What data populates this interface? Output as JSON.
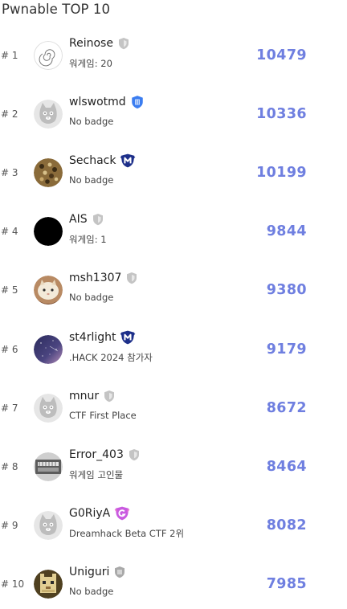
{
  "title": "Pwnable TOP 10",
  "accent_color": "#6f7fe0",
  "rows": [
    {
      "rank": "# 1",
      "name": "Reinose",
      "badge": "gray-shield-icon",
      "sub": "워게임: 20",
      "score": "10479",
      "avatar": "spiral"
    },
    {
      "rank": "# 2",
      "name": "wlswotmd",
      "badge": "blue-shield-icon",
      "sub": "No badge",
      "score": "10336",
      "avatar": "cat"
    },
    {
      "rank": "# 3",
      "name": "Sechack",
      "badge": "navy-m-shield-icon",
      "sub": "No badge",
      "score": "10199",
      "avatar": "leopard"
    },
    {
      "rank": "# 4",
      "name": "AIS",
      "badge": "gray-shield-icon",
      "sub": "워게임: 1",
      "score": "9844",
      "avatar": "black"
    },
    {
      "rank": "# 5",
      "name": "msh1307",
      "badge": "gray-shield-icon",
      "sub": "No badge",
      "score": "9380",
      "avatar": "photo-cat"
    },
    {
      "rank": "# 6",
      "name": "st4rlight",
      "badge": "navy-m-shield-icon",
      "sub": ".HACK 2024 참가자",
      "score": "9179",
      "avatar": "night-sky"
    },
    {
      "rank": "# 7",
      "name": "mnur",
      "badge": "gray-shield-icon",
      "sub": "CTF First Place",
      "score": "8672",
      "avatar": "cat"
    },
    {
      "rank": "# 8",
      "name": "Error_403",
      "badge": "gray-shield-icon",
      "sub": "워게임 고인물",
      "score": "8464",
      "avatar": "machine"
    },
    {
      "rank": "# 9",
      "name": "G0RiyA",
      "badge": "pink-g-shield-icon",
      "sub": "Dreamhack Beta CTF 2위",
      "score": "8082",
      "avatar": "cat"
    },
    {
      "rank": "# 10",
      "name": "Uniguri",
      "badge": "gray-bars-shield-icon",
      "sub": "No badge",
      "score": "7985",
      "avatar": "pixel-cat"
    }
  ]
}
